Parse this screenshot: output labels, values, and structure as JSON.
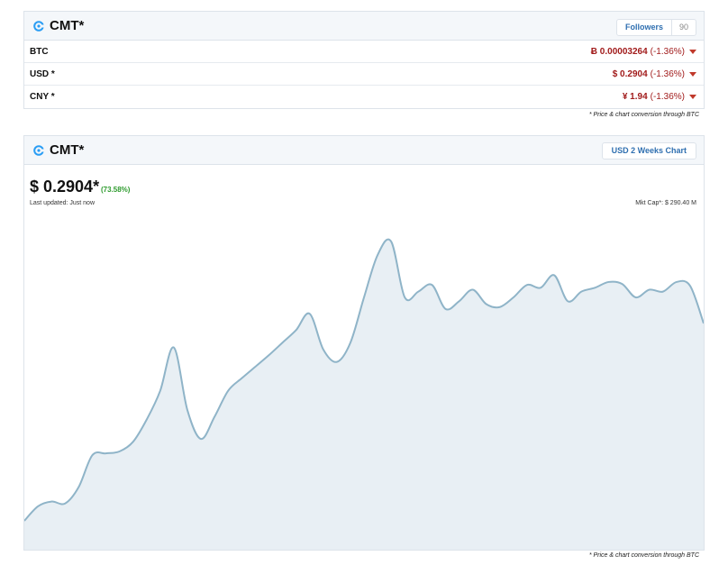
{
  "top_panel": {
    "coin": "CMT*",
    "followers_label": "Followers",
    "followers_count": "90",
    "rows": [
      {
        "label": "BTC",
        "price": "Ƀ 0.00003264",
        "change": "(-1.36%)"
      },
      {
        "label": "USD *",
        "price": "$ 0.2904",
        "change": "(-1.36%)"
      },
      {
        "label": "CNY *",
        "price": "¥ 1.94",
        "change": "(-1.36%)"
      }
    ],
    "note": "* Price & chart conversion through BTC"
  },
  "chart_panel": {
    "coin": "CMT*",
    "chart_button": "USD 2 Weeks Chart",
    "price": "$ 0.2904*",
    "change_pct": "(73.58%)",
    "last_updated": "Last updated: Just now",
    "mkt_cap": "Mkt Cap*: $ 290.40 M",
    "note": "* Price & chart conversion through BTC"
  },
  "colors": {
    "accent_blue": "#2f6fb0",
    "down_red": "#a11b1b",
    "up_green": "#2e9b2e",
    "line": "#8fb4c8",
    "area": "#e8eff4"
  },
  "chart_data": {
    "type": "area",
    "x": [
      0,
      1,
      2,
      3,
      4,
      5,
      6,
      7,
      8,
      9,
      10,
      11,
      12,
      13,
      14,
      15,
      16,
      17,
      18,
      19,
      20,
      21,
      22,
      23,
      24,
      25,
      26,
      27,
      28,
      29,
      30,
      31,
      32,
      33,
      34,
      35,
      36,
      37,
      38,
      39,
      40,
      41,
      42,
      43,
      44,
      45,
      46,
      47,
      48,
      49,
      50
    ],
    "values": [
      0.03,
      0.045,
      0.05,
      0.048,
      0.065,
      0.098,
      0.1,
      0.102,
      0.112,
      0.135,
      0.165,
      0.21,
      0.145,
      0.115,
      0.138,
      0.165,
      0.178,
      0.19,
      0.202,
      0.215,
      0.228,
      0.245,
      0.208,
      0.195,
      0.215,
      0.262,
      0.306,
      0.32,
      0.262,
      0.268,
      0.275,
      0.25,
      0.258,
      0.27,
      0.255,
      0.252,
      0.262,
      0.275,
      0.272,
      0.285,
      0.258,
      0.268,
      0.272,
      0.278,
      0.276,
      0.262,
      0.27,
      0.268,
      0.278,
      0.274,
      0.235
    ],
    "ylim": [
      0,
      0.35
    ],
    "grid": false
  }
}
